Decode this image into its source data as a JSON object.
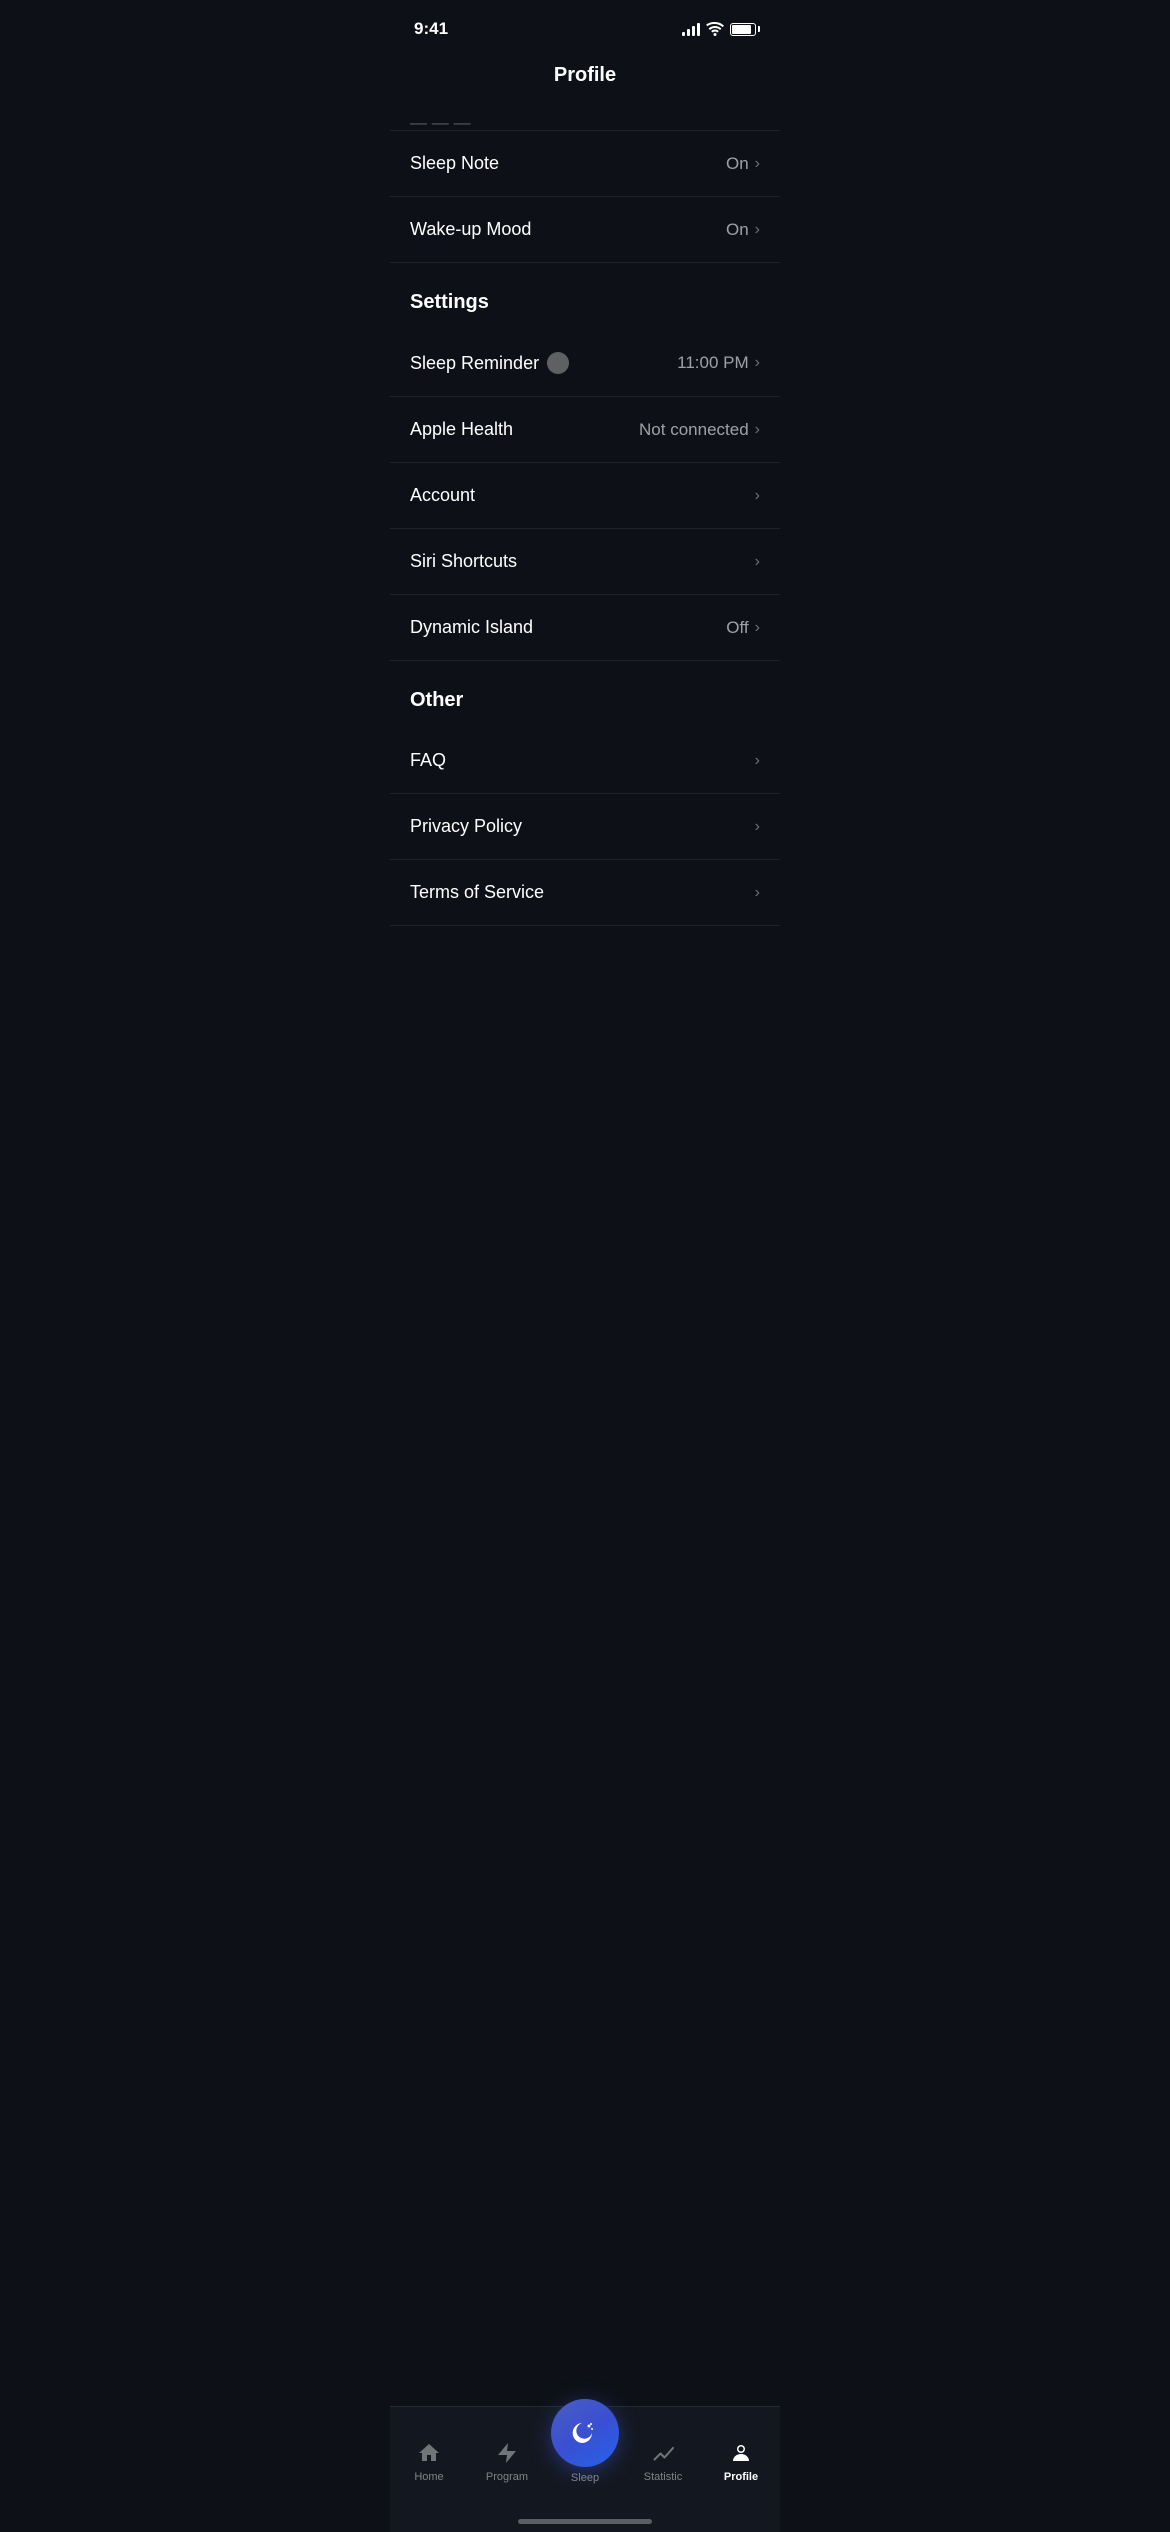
{
  "statusBar": {
    "time": "9:41"
  },
  "header": {
    "title": "Profile"
  },
  "partialItem": {
    "text": "..."
  },
  "sections": [
    {
      "id": "sleep-settings",
      "items": [
        {
          "id": "sleep-note",
          "label": "Sleep Note",
          "value": "On",
          "hasChevron": true,
          "hasToggle": false
        },
        {
          "id": "wakeup-mood",
          "label": "Wake-up Mood",
          "value": "On",
          "hasChevron": true,
          "hasToggle": false
        }
      ]
    },
    {
      "id": "settings",
      "header": "Settings",
      "items": [
        {
          "id": "sleep-reminder",
          "label": "Sleep Reminder",
          "value": "11:00 PM",
          "hasChevron": true,
          "hasToggle": true
        },
        {
          "id": "apple-health",
          "label": "Apple Health",
          "value": "Not connected",
          "hasChevron": true,
          "hasToggle": false
        },
        {
          "id": "account",
          "label": "Account",
          "value": "",
          "hasChevron": true,
          "hasToggle": false
        },
        {
          "id": "siri-shortcuts",
          "label": "Siri Shortcuts",
          "value": "",
          "hasChevron": true,
          "hasToggle": false
        },
        {
          "id": "dynamic-island",
          "label": "Dynamic Island",
          "value": "Off",
          "hasChevron": true,
          "hasToggle": false
        }
      ]
    },
    {
      "id": "other",
      "header": "Other",
      "items": [
        {
          "id": "faq",
          "label": "FAQ",
          "value": "",
          "hasChevron": true,
          "hasToggle": false
        },
        {
          "id": "privacy-policy",
          "label": "Privacy Policy",
          "value": "",
          "hasChevron": true,
          "hasToggle": false
        },
        {
          "id": "terms-of-service",
          "label": "Terms of Service",
          "value": "",
          "hasChevron": true,
          "hasToggle": false
        }
      ]
    }
  ],
  "tabBar": {
    "items": [
      {
        "id": "home",
        "label": "Home",
        "icon": "🏠",
        "active": false
      },
      {
        "id": "program",
        "label": "Program",
        "icon": "⚡",
        "active": false
      },
      {
        "id": "sleep",
        "label": "Sleep",
        "icon": "🌙",
        "active": false,
        "isCenter": true
      },
      {
        "id": "statistic",
        "label": "Statistic",
        "icon": "📈",
        "active": false
      },
      {
        "id": "profile",
        "label": "Profile",
        "icon": "👤",
        "active": true
      }
    ]
  }
}
